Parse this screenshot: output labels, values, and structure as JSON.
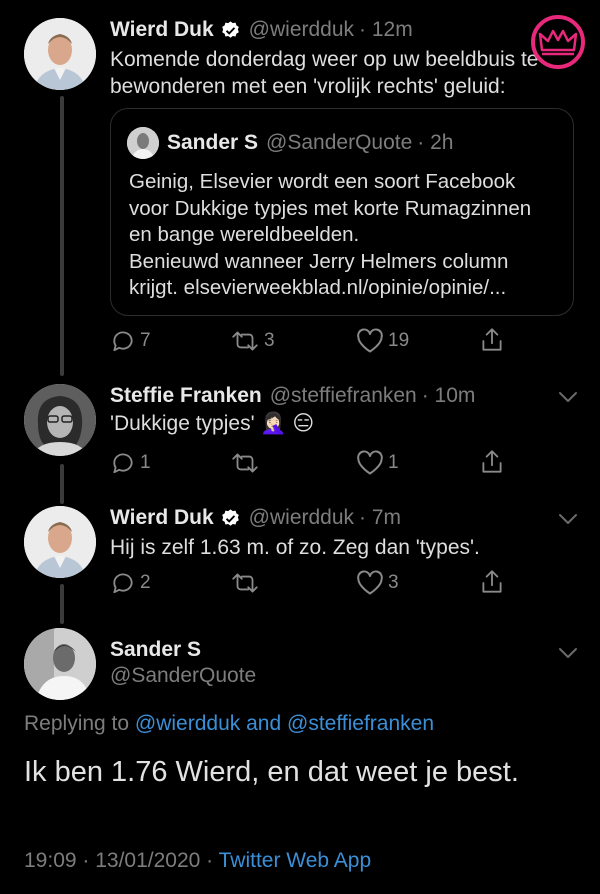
{
  "tweets": [
    {
      "name": "Wierd Duk",
      "handle": "@wierdduk",
      "time": "· 12m",
      "text_lines": [
        "Komende donderdag weer op uw beeldbuis te",
        "bewonderen met een 'vrolijk rechts' geluid:"
      ],
      "quote": {
        "name": "Sander S",
        "handle": "@SanderQuote",
        "time": "· 2h",
        "text_lines": [
          "Geinig, Elsevier wordt een soort Facebook",
          "voor Dukkige typjes met korte Rumagzinnen",
          "en bange wereldbeelden.",
          "Benieuwd wanneer Jerry Helmers column",
          "krijgt. elsevierweekblad.nl/opinie/opinie/..."
        ]
      },
      "replies": "7",
      "retweets": "3",
      "likes": "19"
    },
    {
      "name": "Steffie Franken",
      "handle": "@steffiefranken",
      "time": "· 10m",
      "text": "'Dukkige typjes' 🤦🏻‍♀️ 😑",
      "replies": "1",
      "retweets": "",
      "likes": "1"
    },
    {
      "name": "Wierd Duk",
      "handle": "@wierdduk",
      "time": "· 7m",
      "text": "Hij is zelf 1.63 m. of zo. Zeg dan 'types'.",
      "replies": "2",
      "retweets": "",
      "likes": "3"
    }
  ],
  "main": {
    "name": "Sander S",
    "handle": "@SanderQuote",
    "replying_prefix": "Replying to",
    "reply_to_1": "@wierdduk",
    "reply_and": "and",
    "reply_to_2": "@steffiefranken",
    "text": "Ik ben 1.76 Wierd, en dat weet je best.",
    "timestamp": "19:09 · 13/01/2020 ·",
    "source": "Twitter Web App"
  },
  "colors": {
    "background": "#000000",
    "link": "#3b8fd6",
    "verified": "#ffffff",
    "crown_badge": "#e8287a",
    "thread_line": "#3b3b3b"
  },
  "icons": [
    "verified-icon",
    "reply-icon",
    "retweet-icon",
    "like-icon",
    "share-icon",
    "chevron-down-icon",
    "crown-badge-icon"
  ]
}
